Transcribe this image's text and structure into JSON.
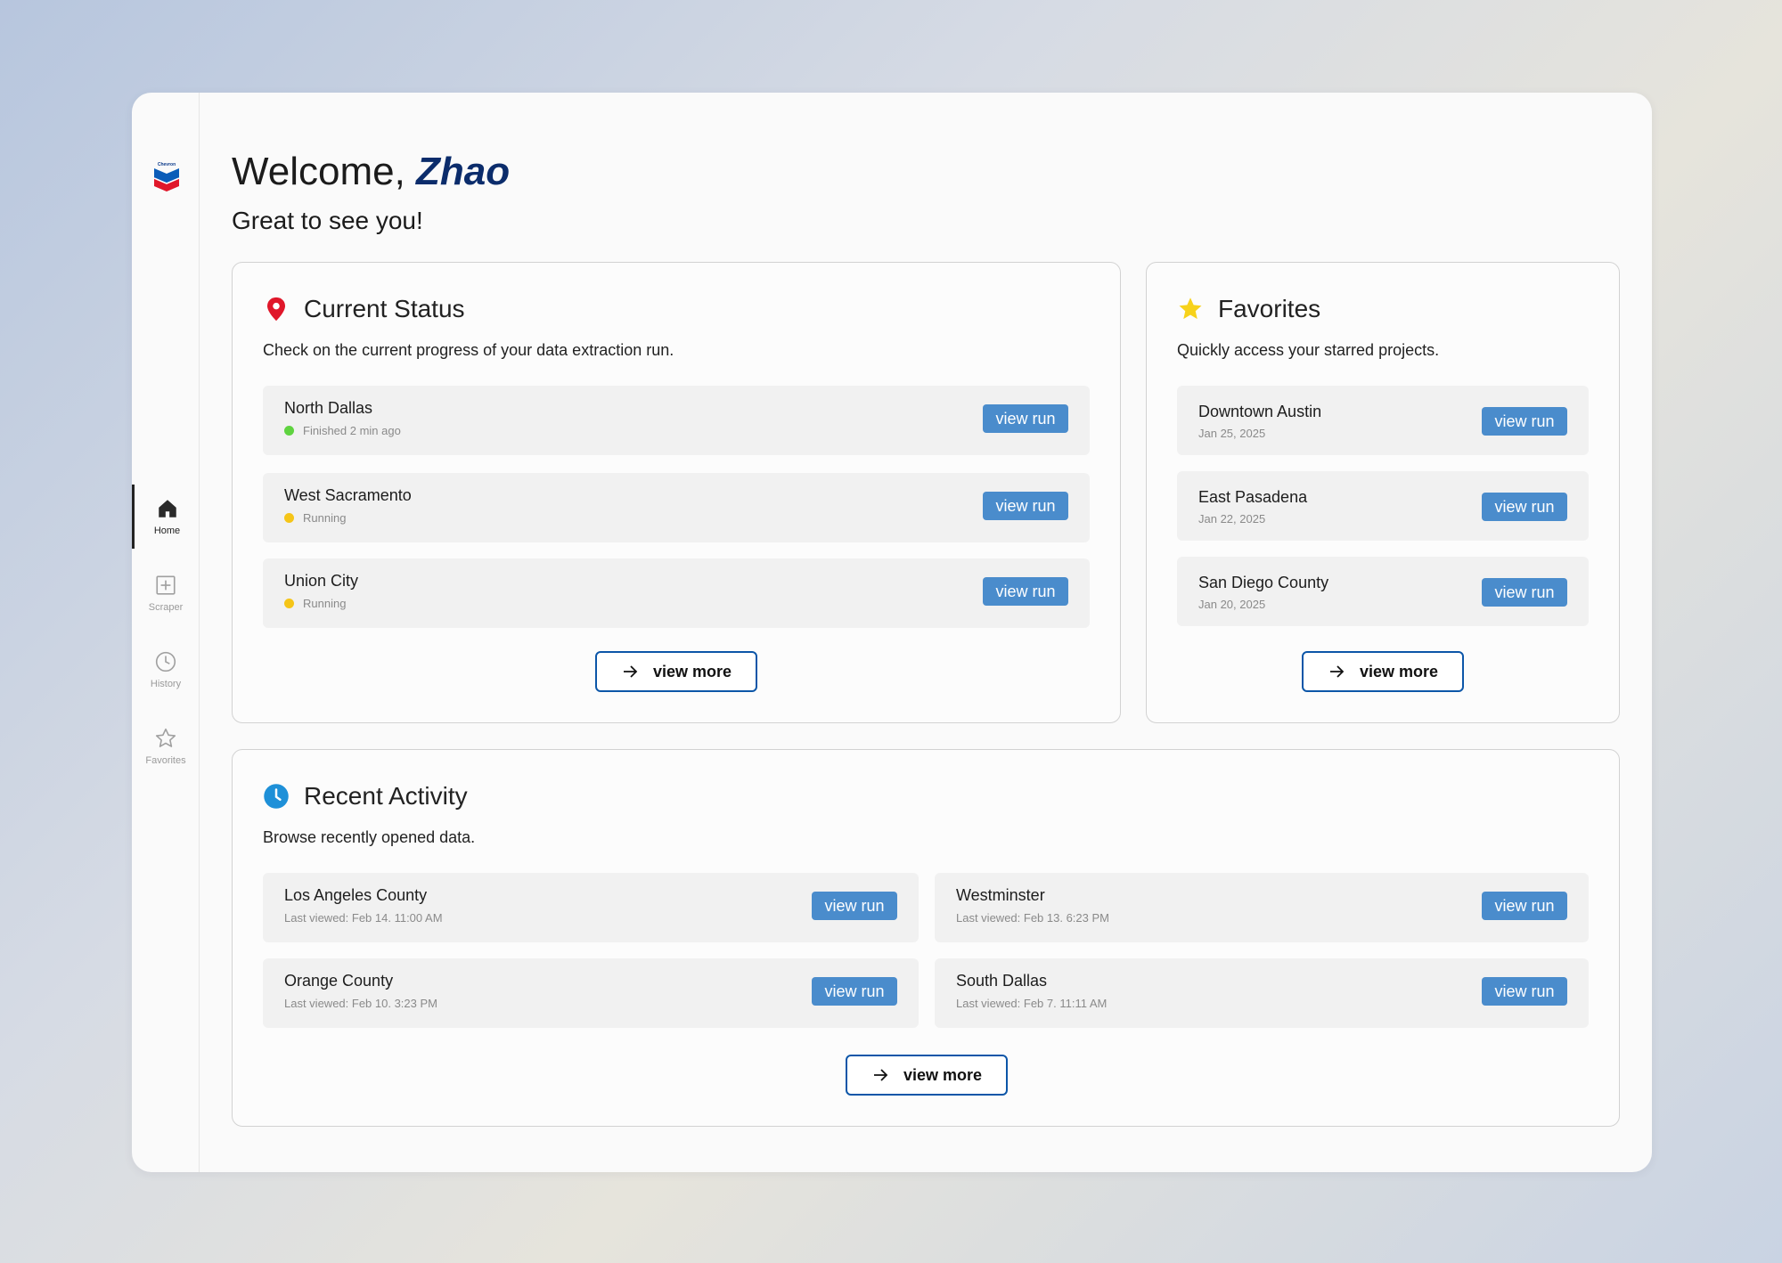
{
  "sidebar": {
    "logo_text": "Chevron",
    "items": [
      {
        "label": "Home",
        "icon": "home-icon",
        "active": true
      },
      {
        "label": "Scraper",
        "icon": "plus-square-icon",
        "active": false
      },
      {
        "label": "History",
        "icon": "clock-icon",
        "active": false
      },
      {
        "label": "Favorites",
        "icon": "star-outline-icon",
        "active": false
      }
    ]
  },
  "header": {
    "greeting": "Welcome,",
    "user_name": "Zhao",
    "subtitle": "Great to see you!"
  },
  "current_status": {
    "title": "Current Status",
    "icon": "location-pin-icon",
    "description": "Check on the current progress of your data extraction run.",
    "rows": [
      {
        "name": "North Dallas",
        "status": "Finished 2 min ago",
        "status_color": "#5fd340",
        "button": "view run"
      },
      {
        "name": "West Sacramento",
        "status": "Running",
        "status_color": "#f5c518",
        "button": "view run"
      },
      {
        "name": "Union City",
        "status": "Running",
        "status_color": "#f5c518",
        "button": "view run"
      }
    ],
    "more_label": "view more"
  },
  "favorites": {
    "title": "Favorites",
    "icon": "star-icon",
    "description": "Quickly access your starred projects.",
    "rows": [
      {
        "name": "Downtown Austin",
        "date": "Jan 25, 2025",
        "button": "view run"
      },
      {
        "name": "East Pasadena",
        "date": "Jan 22, 2025",
        "button": "view run"
      },
      {
        "name": "San Diego County",
        "date": "Jan 20, 2025",
        "button": "view run"
      }
    ],
    "more_label": "view more"
  },
  "recent_activity": {
    "title": "Recent Activity",
    "icon": "clock-icon",
    "description": "Browse recently opened data.",
    "rows": [
      {
        "name": "Los Angeles County",
        "viewed": "Last viewed: Feb 14. 11:00 AM",
        "button": "view run"
      },
      {
        "name": "Westminster",
        "viewed": "Last viewed: Feb 13. 6:23 PM",
        "button": "view run"
      },
      {
        "name": "Orange County",
        "viewed": "Last viewed: Feb 10. 3:23 PM",
        "button": "view run"
      },
      {
        "name": "South Dallas",
        "viewed": "Last viewed: Feb 7. 11:11 AM",
        "button": "view run"
      }
    ],
    "more_label": "view more"
  },
  "colors": {
    "accent": "#0c56a8",
    "button": "#4a8ccc",
    "name": "#0b2c6b",
    "finished": "#5fd340",
    "running": "#f5c518"
  }
}
